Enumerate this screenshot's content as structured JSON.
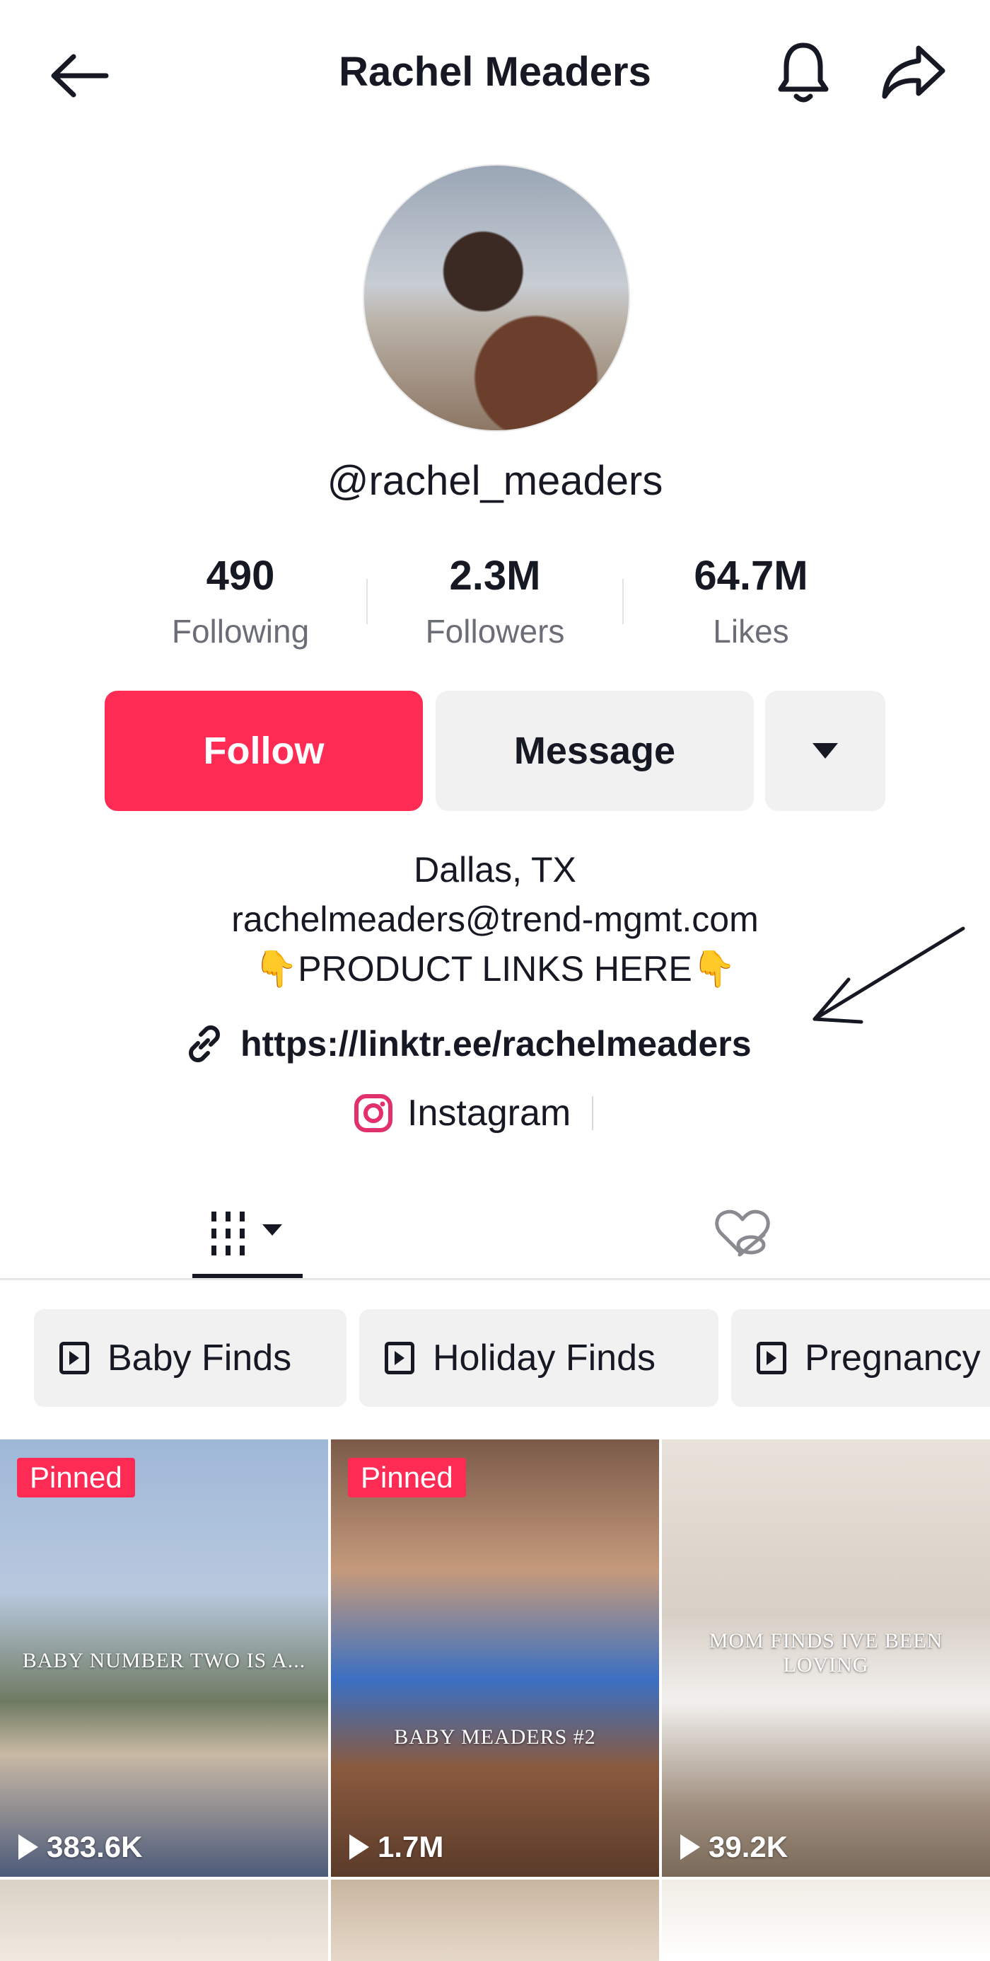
{
  "header": {
    "title": "Rachel Meaders",
    "back_icon": "arrow-left-icon",
    "notify_icon": "bell-icon",
    "share_icon": "share-arrow-icon"
  },
  "profile": {
    "handle": "@rachel_meaders",
    "avatar": "profile-photo"
  },
  "stats": [
    {
      "value": "490",
      "label": "Following"
    },
    {
      "value": "2.3M",
      "label": "Followers"
    },
    {
      "value": "64.7M",
      "label": "Likes"
    }
  ],
  "actions": {
    "follow_label": "Follow",
    "message_label": "Message",
    "more_icon": "caret-down-icon",
    "follow_color": "#fe2c55"
  },
  "bio": {
    "location": "Dallas, TX",
    "email": "rachelmeaders@trend-mgmt.com",
    "product_links": "👇PRODUCT LINKS HERE👇",
    "link": "https://linktr.ee/rachelmeaders",
    "instagram": "Instagram"
  },
  "tabs": {
    "videos_icon": "grid-icon",
    "liked_icon": "heart-hidden-icon"
  },
  "playlists": [
    {
      "label": "Baby Finds"
    },
    {
      "label": "Holiday Finds"
    },
    {
      "label": "Pregnancy"
    }
  ],
  "videos": [
    {
      "pinned": "Pinned",
      "views": "383.6K",
      "overlay": "BABY NUMBER TWO IS A..."
    },
    {
      "pinned": "Pinned",
      "views": "1.7M",
      "overlay": "BABY MEADERS #2"
    },
    {
      "pinned": "",
      "views": "39.2K",
      "overlay": "MOM FINDS IVE BEEN LOVING"
    }
  ]
}
